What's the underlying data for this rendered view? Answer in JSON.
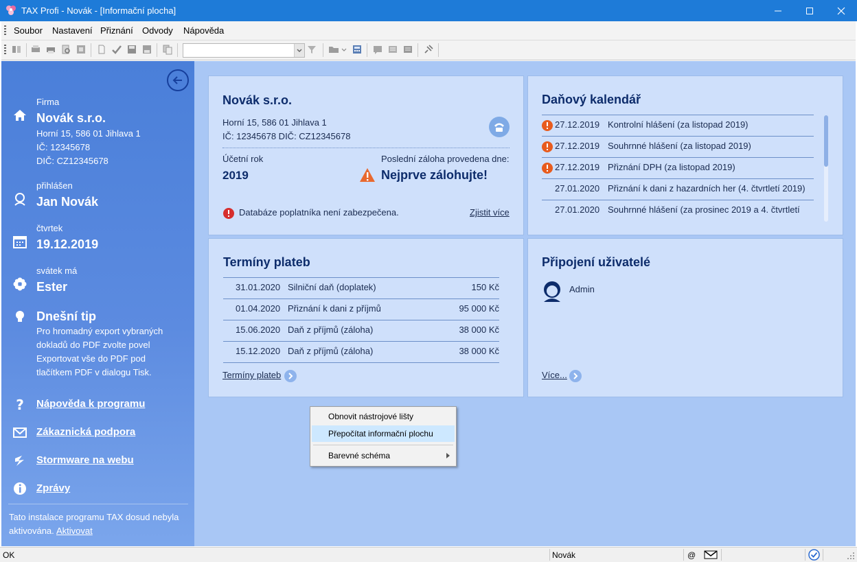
{
  "window": {
    "title": "TAX Profi - Novák - [Informační plocha]",
    "accent_color": "#1e7bd8"
  },
  "menu": {
    "items": [
      "Soubor",
      "Nastavení",
      "Přiznání",
      "Odvody",
      "Nápověda"
    ]
  },
  "left": {
    "company_label": "Firma",
    "company_name": "Novák s.r.o.",
    "company_address": "Horní 15, 586 01 Jihlava 1",
    "company_ic": "IČ: 12345678",
    "company_dic": "DIČ: CZ12345678",
    "user_label": "přihlášen",
    "user_name": "Jan Novák",
    "day_label": "čtvrtek",
    "date": "19.12.2019",
    "nameday_label": "svátek má",
    "nameday_name": "Ester",
    "tip_title": "Dnešní tip",
    "tip_lines": [
      "Pro hromadný export vybraných",
      "dokladů do PDF zvolte povel",
      "Exportovat vše do PDF pod",
      "tlačítkem PDF v dialogu Tisk."
    ],
    "links": [
      "Nápověda k programu",
      "Zákaznická podpora",
      "Stormware na webu",
      "Zprávy"
    ],
    "activation_text_1": "Tato instalace programu TAX dosud nebyla",
    "activation_text_2": "aktivována.",
    "activation_link": "Aktivovat"
  },
  "company_card": {
    "title": "Novák s.r.o.",
    "address": "Horní 15, 586 01 Jihlava 1",
    "ids": "IČ: 12345678  DIČ: CZ12345678",
    "year_label": "Účetní rok",
    "year": "2019",
    "backup_label": "Poslední záloha provedena dne:",
    "backup_value": "Nejprve zálohujte!",
    "warning_text": "Databáze poplatníka není zabezpečena.",
    "more_link": "Zjistit více"
  },
  "tax_calendar": {
    "title": "Daňový kalendář",
    "items": [
      {
        "date": "27.12.2019",
        "text": "Kontrolní hlášení (za listopad 2019)",
        "alert": true
      },
      {
        "date": "27.12.2019",
        "text": "Souhrnné hlášení (za listopad 2019)",
        "alert": true
      },
      {
        "date": "27.12.2019",
        "text": "Přiznání DPH (za listopad 2019)",
        "alert": true
      },
      {
        "date": "27.01.2020",
        "text": "Přiznání k dani z hazardních her (4. čtvrtletí 2019)",
        "alert": false
      },
      {
        "date": "27.01.2020",
        "text": "Souhrnné hlášení (za prosinec 2019 a 4. čtvrtletí",
        "alert": false
      }
    ]
  },
  "payments": {
    "title": "Termíny plateb",
    "rows": [
      {
        "date": "31.01.2020",
        "name": "Silniční daň (doplatek)",
        "amount": "150 Kč"
      },
      {
        "date": "01.04.2020",
        "name": "Přiznání k dani z příjmů",
        "amount": "95 000 Kč"
      },
      {
        "date": "15.06.2020",
        "name": "Daň z příjmů (záloha)",
        "amount": "38 000 Kč"
      },
      {
        "date": "15.12.2020",
        "name": "Daň z příjmů (záloha)",
        "amount": "38 000 Kč"
      }
    ],
    "link": "Termíny plateb"
  },
  "users": {
    "title": "Připojení uživatelé",
    "user": "Admin",
    "more_link": "Více..."
  },
  "context_menu": {
    "items": [
      "Obnovit nástrojové lišty",
      "Přepočítat informační plochu",
      "Barevné schéma"
    ]
  },
  "status": {
    "left": "OK",
    "user": "Novák",
    "at_symbol": "@"
  },
  "icons": {
    "back": "arrow-left-circle-icon",
    "home": "home-icon",
    "user": "user-icon",
    "calendar": "calendar-icon",
    "nameday": "flower-icon",
    "tip": "lightbulb-icon",
    "help": "question-icon",
    "mail": "envelope-icon",
    "web": "stormware-icon",
    "info": "info-icon"
  }
}
